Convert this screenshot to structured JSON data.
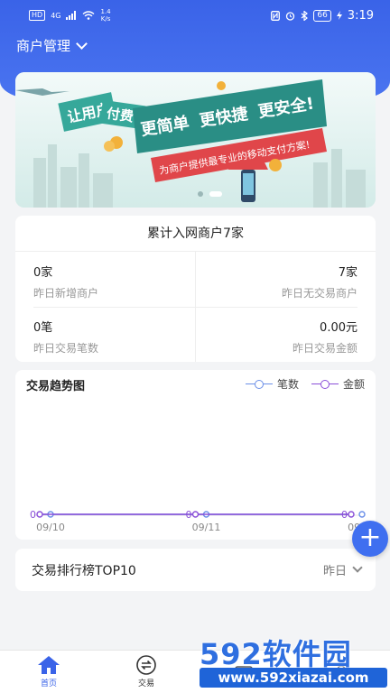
{
  "status_bar": {
    "left_badge": "HD",
    "network": "4G",
    "speed_value": "1.4",
    "speed_unit": "K/s",
    "battery": "66",
    "time": "3:19"
  },
  "header": {
    "merchant_label": "商户管理"
  },
  "banner": {
    "tag1": "让用户",
    "tag2": "付费",
    "slogan1": "更简单",
    "slogan2": "更快捷",
    "slogan3": "更安全!",
    "subtitle": "为商户提供最专业的移动支付方案!"
  },
  "stats": {
    "title": "累计入网商户7家",
    "items": [
      {
        "value": "0家",
        "label": "昨日新增商户"
      },
      {
        "value": "7家",
        "label": "昨日无交易商户"
      },
      {
        "value": "0笔",
        "label": "昨日交易笔数"
      },
      {
        "value": "0.00元",
        "label": "昨日交易金额"
      }
    ]
  },
  "chart_data": {
    "type": "line",
    "title": "交易趋势图",
    "x": [
      "09/10",
      "09/11",
      "09/12"
    ],
    "series": [
      {
        "name": "笔数",
        "values": [
          0,
          0,
          0
        ],
        "color": "#6b8fe8"
      },
      {
        "name": "金额",
        "values": [
          0,
          0,
          0
        ],
        "color": "#8a4fd8"
      }
    ],
    "legend_position": "top-right",
    "grid": false
  },
  "ranking": {
    "title": "交易排行榜TOP10",
    "filter": "昨日"
  },
  "fab": {
    "label": "+"
  },
  "tabbar": {
    "items": [
      {
        "label": "首页",
        "icon": "home-icon",
        "active": true
      },
      {
        "label": "交易",
        "icon": "exchange-icon",
        "active": false
      },
      {
        "label": "",
        "icon": "",
        "active": false
      },
      {
        "label": "",
        "icon": "",
        "active": false
      }
    ]
  },
  "watermark": {
    "brand": "592软件园",
    "url": "www.592xiazai.com"
  },
  "colors": {
    "primary": "#3a63e8",
    "count_series": "#6b8fe8",
    "amount_series": "#8a4fd8",
    "banner_red": "#e0464a",
    "banner_teal": "#36a89a"
  }
}
